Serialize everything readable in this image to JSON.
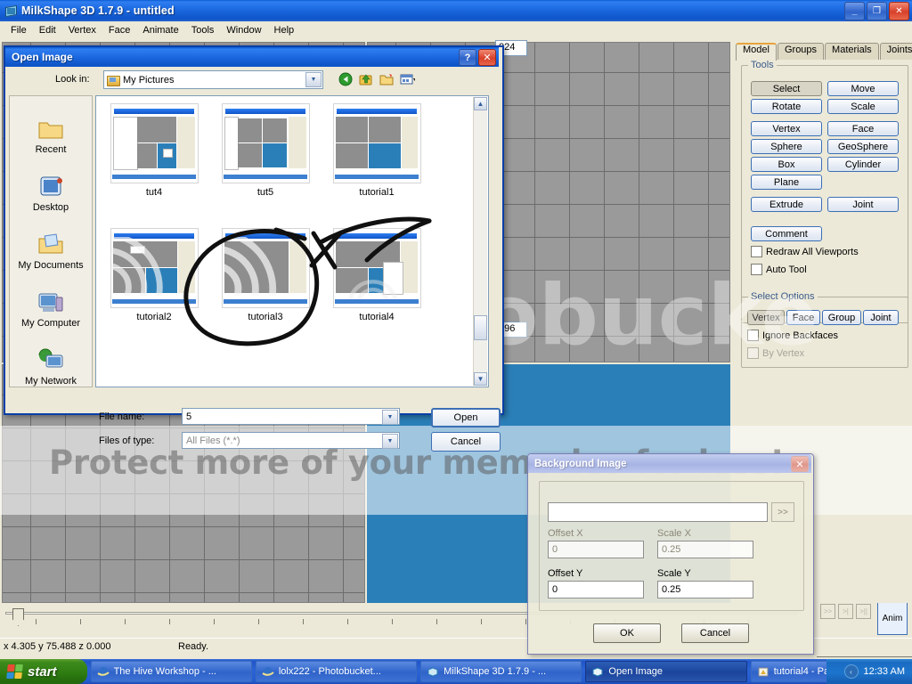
{
  "app": {
    "title": "MilkShape 3D 1.7.9 - untitled",
    "menu": [
      "File",
      "Edit",
      "Vertex",
      "Face",
      "Animate",
      "Tools",
      "Window",
      "Help"
    ],
    "window_buttons": {
      "minimize": "_",
      "maximize": "❐",
      "close": "✕"
    }
  },
  "viewport": {
    "field_top": "024",
    "field_bottom": "096"
  },
  "watermark": {
    "line": "Protect more of your memories for less!",
    "brand": "obucke"
  },
  "status": {
    "coords": "x 4.305 y 75.488 z 0.000",
    "ready": "Ready."
  },
  "anim_controls": {
    "buttons": [
      ">>",
      ">|",
      ">||"
    ],
    "anim_label": "Anim"
  },
  "toolpanel": {
    "tabs": [
      {
        "label": "Model",
        "active": true
      },
      {
        "label": "Groups",
        "active": false
      },
      {
        "label": "Materials",
        "active": false
      },
      {
        "label": "Joints",
        "active": false
      }
    ],
    "tools_group_label": "Tools",
    "tool_buttons": [
      {
        "label": "Select",
        "pressed": true
      },
      {
        "label": "Move",
        "pressed": false
      },
      {
        "label": "Rotate",
        "pressed": false
      },
      {
        "label": "Scale",
        "pressed": false
      },
      {
        "label": "Vertex",
        "pressed": false
      },
      {
        "label": "Face",
        "pressed": false
      },
      {
        "label": "Sphere",
        "pressed": false
      },
      {
        "label": "GeoSphere",
        "pressed": false
      },
      {
        "label": "Box",
        "pressed": false
      },
      {
        "label": "Cylinder",
        "pressed": false
      },
      {
        "label": "Plane",
        "pressed": false
      },
      {
        "label": "Extrude",
        "pressed": false
      },
      {
        "label": "Joint",
        "pressed": false
      }
    ],
    "comment_button": "Comment",
    "checkboxes": [
      {
        "label": "Redraw All Viewports",
        "checked": false,
        "disabled": false
      },
      {
        "label": "Auto Tool",
        "checked": false,
        "disabled": false
      }
    ],
    "select_options_label": "Select Options",
    "select_modes": [
      {
        "label": "Vertex",
        "selected": true
      },
      {
        "label": "Face",
        "selected": false
      },
      {
        "label": "Group",
        "selected": false
      },
      {
        "label": "Joint",
        "selected": false
      }
    ],
    "select_checkboxes": [
      {
        "label": "Ignore Backfaces",
        "checked": false,
        "disabled": false
      },
      {
        "label": "By Vertex",
        "checked": false,
        "disabled": true
      }
    ]
  },
  "open_dialog": {
    "title": "Open Image",
    "help_button": "?",
    "close_button": "✕",
    "look_in_label": "Look in:",
    "look_in_value": "My Pictures",
    "nav_icons": [
      "back-icon",
      "up-one-level-icon",
      "new-folder-icon",
      "views-icon"
    ],
    "places": [
      {
        "label": "Recent",
        "icon": "recent-folder-icon"
      },
      {
        "label": "Desktop",
        "icon": "desktop-icon"
      },
      {
        "label": "My Documents",
        "icon": "my-documents-icon"
      },
      {
        "label": "My Computer",
        "icon": "my-computer-icon"
      },
      {
        "label": "My Network",
        "icon": "my-network-icon"
      }
    ],
    "files": [
      {
        "name": "tut4",
        "kind": "screenshot"
      },
      {
        "name": "tut5",
        "kind": "screenshot"
      },
      {
        "name": "tutorial1",
        "kind": "screenshot"
      },
      {
        "name": "tutorial2",
        "kind": "swirl"
      },
      {
        "name": "tutorial3",
        "kind": "swirl-selected"
      },
      {
        "name": "tutorial4",
        "kind": "menu"
      }
    ],
    "file_name_label": "File name:",
    "file_name_value": "5",
    "files_of_type_label": "Files of type:",
    "files_of_type_value": "All Files (*.*)",
    "open_button": "Open",
    "cancel_button": "Cancel"
  },
  "background_dialog": {
    "title": "Background Image",
    "close_button": "✕",
    "path_value": "",
    "browse_button": ">>",
    "fields": [
      {
        "label": "Offset X",
        "value": "0",
        "dim": true
      },
      {
        "label": "Scale X",
        "value": "0.25",
        "dim": true
      },
      {
        "label": "Offset Y",
        "value": "0",
        "dim": false
      },
      {
        "label": "Scale Y",
        "value": "0.25",
        "dim": false
      }
    ],
    "ok_button": "OK",
    "cancel_button": "Cancel"
  },
  "taskbar": {
    "start_label": "start",
    "items": [
      {
        "label": "The Hive Workshop - ...",
        "active": false,
        "icon": "ie-icon"
      },
      {
        "label": "lolx222 - Photobucket...",
        "active": false,
        "icon": "ie-icon"
      },
      {
        "label": "MilkShape 3D 1.7.9 - ...",
        "active": false,
        "icon": "milkshape-icon"
      },
      {
        "label": "Open Image",
        "active": true,
        "icon": "milkshape-icon"
      },
      {
        "label": "tutorial4 - Paint",
        "active": false,
        "icon": "paint-icon"
      }
    ],
    "tray_arrow": "‹",
    "clock": "12:33 AM"
  },
  "colors": {
    "xp_blue": "#1b68e0",
    "face_beige": "#ece9d8",
    "viewport_gray": "#9a9a9a",
    "selected_blue": "#2b7fb8",
    "taskbar_blue": "#245ccf",
    "start_green": "#2f7d12"
  }
}
